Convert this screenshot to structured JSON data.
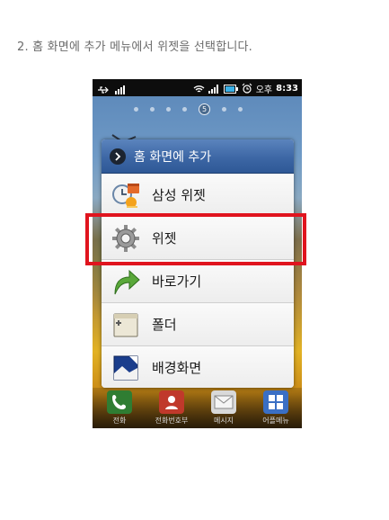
{
  "instruction": "2. 홈 화면에 추가 메뉴에서 위젯을 선택합니다.",
  "status_bar": {
    "time": "8:33",
    "ampm": "오후",
    "battery_indicator": "battery-icon",
    "signal_indicator": "signal-icon",
    "wifi_indicator": "wifi-icon",
    "alarm_indicator": "alarm-icon",
    "usb_indicator": "usb-icon"
  },
  "home": {
    "current_page": "5"
  },
  "dialog": {
    "title": "홈 화면에 추가",
    "items": [
      {
        "label": "삼성 위젯",
        "icon": "samsung-widget-icon"
      },
      {
        "label": "위젯",
        "icon": "gear-icon"
      },
      {
        "label": "바로가기",
        "icon": "shortcut-arrow-icon"
      },
      {
        "label": "폴더",
        "icon": "folder-icon"
      },
      {
        "label": "배경화면",
        "icon": "wallpaper-icon"
      }
    ],
    "highlighted_item": "위젯"
  },
  "dock": {
    "items": [
      {
        "label": "전화",
        "color": "#2f7d32"
      },
      {
        "label": "전화번호부",
        "color": "#c0392b"
      },
      {
        "label": "메시지",
        "color": "#e3e3e3"
      },
      {
        "label": "어플메뉴",
        "color": "#3a6fc4"
      }
    ]
  },
  "colors": {
    "highlight": "#e0141e",
    "header": "#3d67a5"
  }
}
